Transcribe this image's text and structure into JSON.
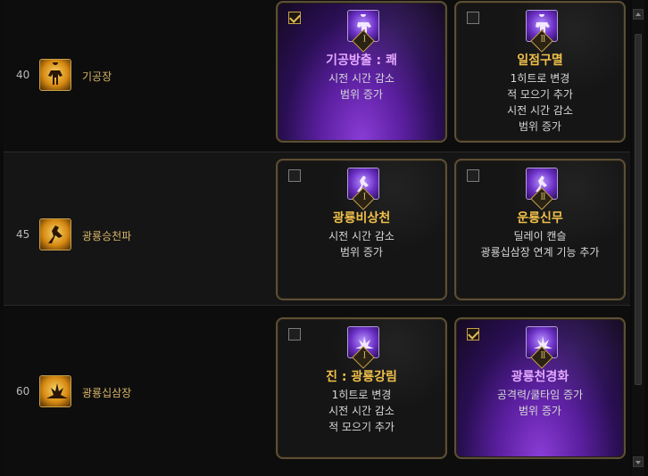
{
  "rows": [
    {
      "level": "40",
      "skill": {
        "name": "기공장",
        "icon": "kigong-palm-icon"
      },
      "options": [
        {
          "selected": true,
          "rune": "Ⅰ",
          "title": "기공방출 : 쾌",
          "lines": [
            "시전 시간 감소",
            "범위 증가"
          ]
        },
        {
          "selected": false,
          "rune": "Ⅱ",
          "title": "일점구멸",
          "lines": [
            "1히트로 변경",
            "적 모으기 추가",
            "시전 시간 감소",
            "범위 증가"
          ]
        }
      ]
    },
    {
      "level": "45",
      "skill": {
        "name": "광룡승천파",
        "icon": "rising-dragon-icon"
      },
      "options": [
        {
          "selected": false,
          "rune": "Ⅰ",
          "title": "광룡비상천",
          "lines": [
            "시전 시간 감소",
            "범위 증가"
          ]
        },
        {
          "selected": false,
          "rune": "Ⅱ",
          "title": "운룡신무",
          "lines": [
            "딜레이 캔슬",
            "광룡십삼장 연계 기능 추가"
          ]
        }
      ]
    },
    {
      "level": "60",
      "skill": {
        "name": "광룡십삼장",
        "icon": "thirteen-palms-icon"
      },
      "options": [
        {
          "selected": false,
          "rune": "Ⅰ",
          "title": "진 : 광룡강림",
          "lines": [
            "1히트로 변경",
            "시전 시간 감소",
            "적 모으기 추가"
          ]
        },
        {
          "selected": true,
          "rune": "Ⅱ",
          "title": "광룡천경화",
          "lines": [
            "공격력/쿨타임 증가",
            "범위 증가"
          ]
        }
      ]
    }
  ],
  "colors": {
    "accent": "#f0c04a",
    "selected_purple": "#6b2fc5",
    "selected_title": "#e4a9ff"
  }
}
